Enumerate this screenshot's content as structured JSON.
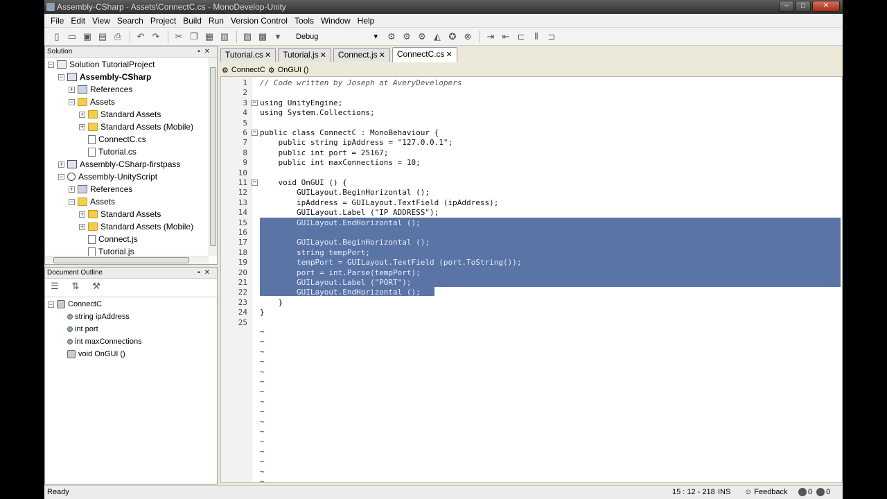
{
  "window": {
    "title": "Assembly-CSharp - Assets\\ConnectC.cs - MonoDevelop-Unity",
    "minimize": "–",
    "maximize": "□",
    "close": "✕"
  },
  "menu": [
    "File",
    "Edit",
    "View",
    "Search",
    "Project",
    "Build",
    "Run",
    "Version Control",
    "Tools",
    "Window",
    "Help"
  ],
  "toolbar": {
    "config": "Debug"
  },
  "solution": {
    "header": "Solution",
    "items": [
      {
        "label": "Solution TutorialProject",
        "exp": "−",
        "icon": "sln",
        "depth": 0,
        "bold": false
      },
      {
        "label": "Assembly-CSharp",
        "exp": "−",
        "icon": "proj",
        "depth": 1,
        "bold": true
      },
      {
        "label": "References",
        "exp": "+",
        "icon": "ref",
        "depth": 2,
        "bold": false
      },
      {
        "label": "Assets",
        "exp": "−",
        "icon": "folder",
        "depth": 2,
        "bold": false
      },
      {
        "label": "Standard Assets",
        "exp": "+",
        "icon": "folder",
        "depth": 3,
        "bold": false
      },
      {
        "label": "Standard Assets (Mobile)",
        "exp": "+",
        "icon": "folder",
        "depth": 3,
        "bold": false
      },
      {
        "label": "ConnectC.cs",
        "exp": "",
        "icon": "file",
        "depth": 3,
        "bold": false
      },
      {
        "label": "Tutorial.cs",
        "exp": "",
        "icon": "file",
        "depth": 3,
        "bold": false
      },
      {
        "label": "Assembly-CSharp-firstpass",
        "exp": "+",
        "icon": "proj",
        "depth": 1,
        "bold": false
      },
      {
        "label": "Assembly-UnityScript",
        "exp": "−",
        "icon": "unity",
        "depth": 1,
        "bold": false
      },
      {
        "label": "References",
        "exp": "+",
        "icon": "ref",
        "depth": 2,
        "bold": false
      },
      {
        "label": "Assets",
        "exp": "−",
        "icon": "folder",
        "depth": 2,
        "bold": false
      },
      {
        "label": "Standard Assets",
        "exp": "+",
        "icon": "folder",
        "depth": 3,
        "bold": false
      },
      {
        "label": "Standard Assets (Mobile)",
        "exp": "+",
        "icon": "folder",
        "depth": 3,
        "bold": false
      },
      {
        "label": "Connect.js",
        "exp": "",
        "icon": "file",
        "depth": 3,
        "bold": false
      },
      {
        "label": "Tutorial.js",
        "exp": "",
        "icon": "file",
        "depth": 3,
        "bold": false
      }
    ]
  },
  "outline": {
    "header": "Document Outline",
    "items": [
      {
        "label": "ConnectC",
        "icon": "cls",
        "exp": "−",
        "depth": 0
      },
      {
        "label": "string ipAddress",
        "icon": "dot",
        "exp": "",
        "depth": 1
      },
      {
        "label": "int port",
        "icon": "dot",
        "exp": "",
        "depth": 1
      },
      {
        "label": "int maxConnections",
        "icon": "dot",
        "exp": "",
        "depth": 1
      },
      {
        "label": "void OnGUI ()",
        "icon": "cls",
        "exp": "",
        "depth": 1
      }
    ]
  },
  "tabs": [
    {
      "label": "Tutorial.cs",
      "active": false
    },
    {
      "label": "Tutorial.js",
      "active": false
    },
    {
      "label": "Connect.js",
      "active": false
    },
    {
      "label": "ConnectC.cs",
      "active": true
    }
  ],
  "breadcrumb": [
    "ConnectC",
    "OnGUI ()"
  ],
  "code": [
    {
      "n": "1",
      "t": "// Code written by Joseph at AveryDevelopers",
      "fold": ""
    },
    {
      "n": "2",
      "t": "",
      "fold": ""
    },
    {
      "n": "3",
      "t": "using UnityEngine;",
      "fold": "−"
    },
    {
      "n": "4",
      "t": "using System.Collections;",
      "fold": ""
    },
    {
      "n": "5",
      "t": "",
      "fold": ""
    },
    {
      "n": "6",
      "t": "public class ConnectC : MonoBehaviour {",
      "fold": "−"
    },
    {
      "n": "7",
      "t": "    public string ipAddress = \"127.0.0.1\";",
      "fold": ""
    },
    {
      "n": "8",
      "t": "    public int port = 25167;",
      "fold": ""
    },
    {
      "n": "9",
      "t": "    public int maxConnections = 10;",
      "fold": ""
    },
    {
      "n": "10",
      "t": "",
      "fold": ""
    },
    {
      "n": "11",
      "t": "    void OnGUI () {",
      "fold": "−"
    },
    {
      "n": "12",
      "t": "        GUILayout.BeginHorizontal ();",
      "fold": ""
    },
    {
      "n": "13",
      "t": "        ipAddress = GUILayout.TextField (ipAddress);",
      "fold": ""
    },
    {
      "n": "14",
      "t": "        GUILayout.Label (\"IP ADDRESS\");",
      "fold": ""
    },
    {
      "n": "15",
      "t": "        GUILayout.EndHorizontal ();",
      "fold": ""
    },
    {
      "n": "16",
      "t": "",
      "fold": ""
    },
    {
      "n": "17",
      "t": "        GUILayout.BeginHorizontal ();",
      "fold": ""
    },
    {
      "n": "18",
      "t": "        string tempPort;",
      "fold": ""
    },
    {
      "n": "19",
      "t": "        tempPort = GUILayout.TextField (port.ToString());",
      "fold": ""
    },
    {
      "n": "20",
      "t": "        port = int.Parse(tempPort);",
      "fold": ""
    },
    {
      "n": "21",
      "t": "        GUILayout.Label (\"PORT\");",
      "fold": ""
    },
    {
      "n": "22",
      "t": "        GUILayout.EndHorizontal ();",
      "fold": ""
    },
    {
      "n": "23",
      "t": "    }",
      "fold": ""
    },
    {
      "n": "24",
      "t": "}",
      "fold": ""
    },
    {
      "n": "25",
      "t": "",
      "fold": ""
    }
  ],
  "status": {
    "left": "Ready",
    "position": "15 : 12 - 218",
    "mode": "INS",
    "feedback": "Feedback",
    "errors": "0",
    "warnings": "0"
  },
  "colors": {
    "selection": "#3d5c96",
    "titlebar": "#3a3a3a"
  }
}
